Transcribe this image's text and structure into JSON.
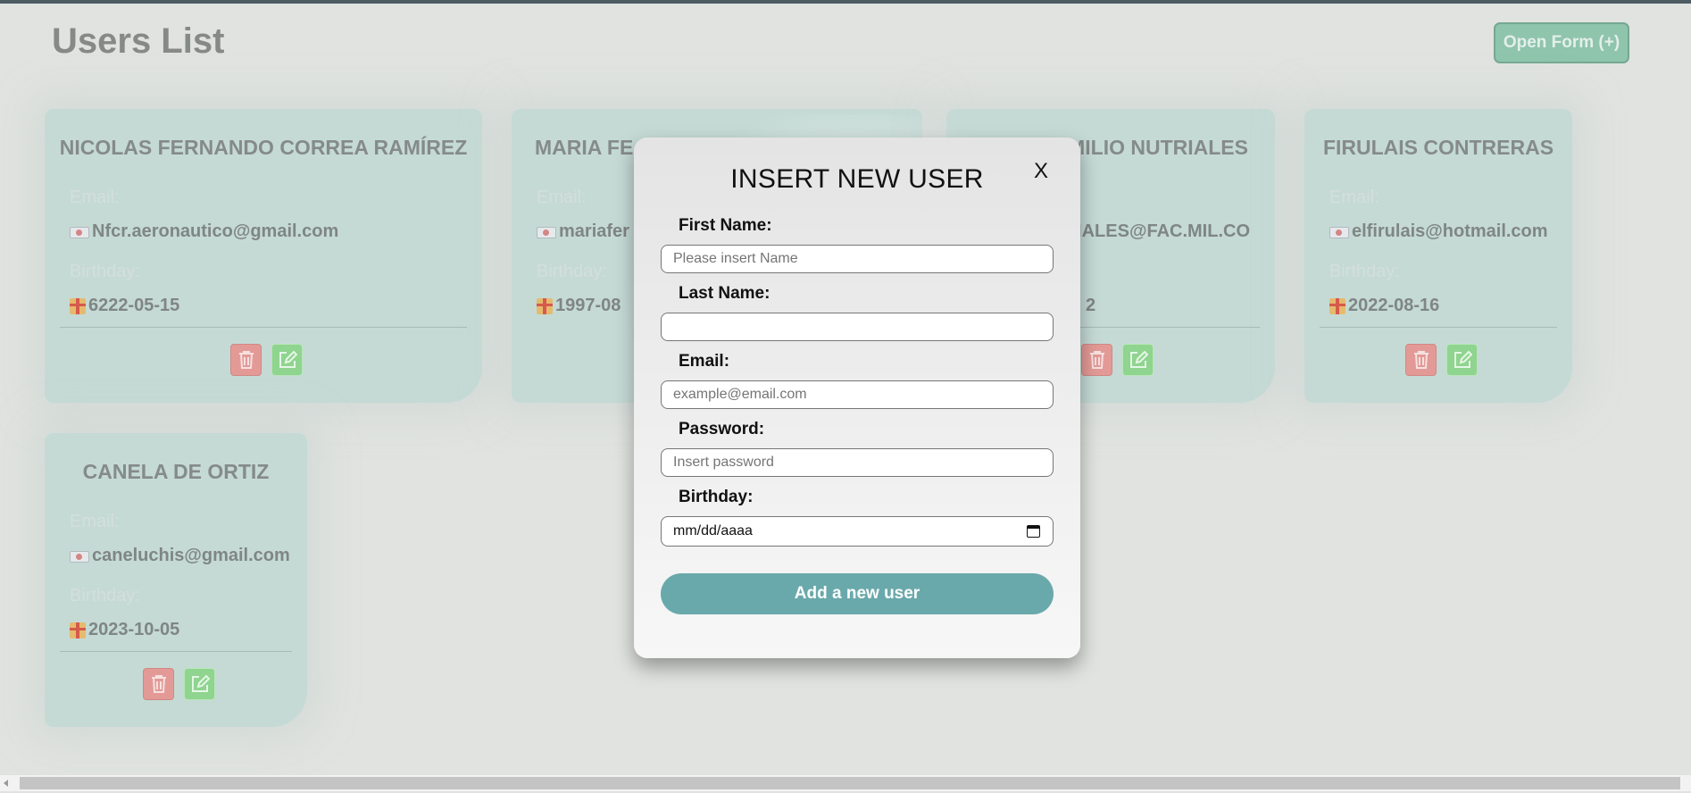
{
  "header": {
    "title": "Users List",
    "open_form_label": "Open Form (+)"
  },
  "labels": {
    "email": "Email:",
    "birthday": "Birthday:"
  },
  "cards": [
    {
      "name": "NICOLAS FERNANDO CORREA RAMÍREZ",
      "email": "Nfcr.aeronautico@gmail.com",
      "birthday": "6222-05-15"
    },
    {
      "name": "MARIA FE",
      "email": "mariafer",
      "birthday": "1997-08"
    },
    {
      "name": "MILIO NUTRIALES",
      "email": "RIALES@FAC.MIL.CO",
      "birthday": "2"
    },
    {
      "name": "FIRULAIS CONTRERAS",
      "email": "elfirulais@hotmail.com",
      "birthday": "2022-08-16"
    },
    {
      "name": "CANELA DE ORTIZ",
      "email": "caneluchis@gmail.com",
      "birthday": "2023-10-05"
    }
  ],
  "modal": {
    "title": "INSERT NEW USER",
    "close_label": "X",
    "first_name": {
      "label": "First Name:",
      "placeholder": "Please insert Name",
      "value": ""
    },
    "last_name": {
      "label": "Last Name:",
      "placeholder": "",
      "value": ""
    },
    "email": {
      "label": "Email:",
      "placeholder": "example@email.com",
      "value": ""
    },
    "password": {
      "label": "Password:",
      "placeholder": "Insert password",
      "value": ""
    },
    "birthday": {
      "label": "Birthday:",
      "value_text": "mm/dd/aaaa"
    },
    "submit_label": "Add a new user"
  },
  "colors": {
    "accent": "#6aa9ab",
    "card_bg": "#c5dad5",
    "delete": "#e39a96",
    "edit": "#8fd48f"
  },
  "icons": {
    "email": "envelope-icon",
    "birthday": "gift-icon",
    "delete": "trash-icon",
    "edit": "pencil-square-icon",
    "calendar": "calendar-icon"
  }
}
